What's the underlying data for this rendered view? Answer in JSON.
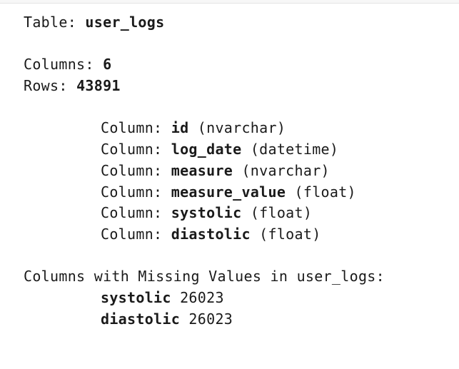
{
  "table_line": {
    "label": "Table:",
    "value": "user_logs"
  },
  "columns_count": {
    "label": "Columns:",
    "value": "6"
  },
  "rows_count": {
    "label": "Rows:",
    "value": "43891"
  },
  "column_prefix": "Column:",
  "columns": [
    {
      "name": "id",
      "type": "(nvarchar)"
    },
    {
      "name": "log_date",
      "type": "(datetime)"
    },
    {
      "name": "measure",
      "type": "(nvarchar)"
    },
    {
      "name": "measure_value",
      "type": "(float)"
    },
    {
      "name": "systolic",
      "type": "(float)"
    },
    {
      "name": "diastolic",
      "type": "(float)"
    }
  ],
  "missing": {
    "header": "Columns with Missing Values in user_logs:",
    "items": [
      {
        "name": "systolic",
        "count": "26023"
      },
      {
        "name": "diastolic",
        "count": "26023"
      }
    ]
  }
}
